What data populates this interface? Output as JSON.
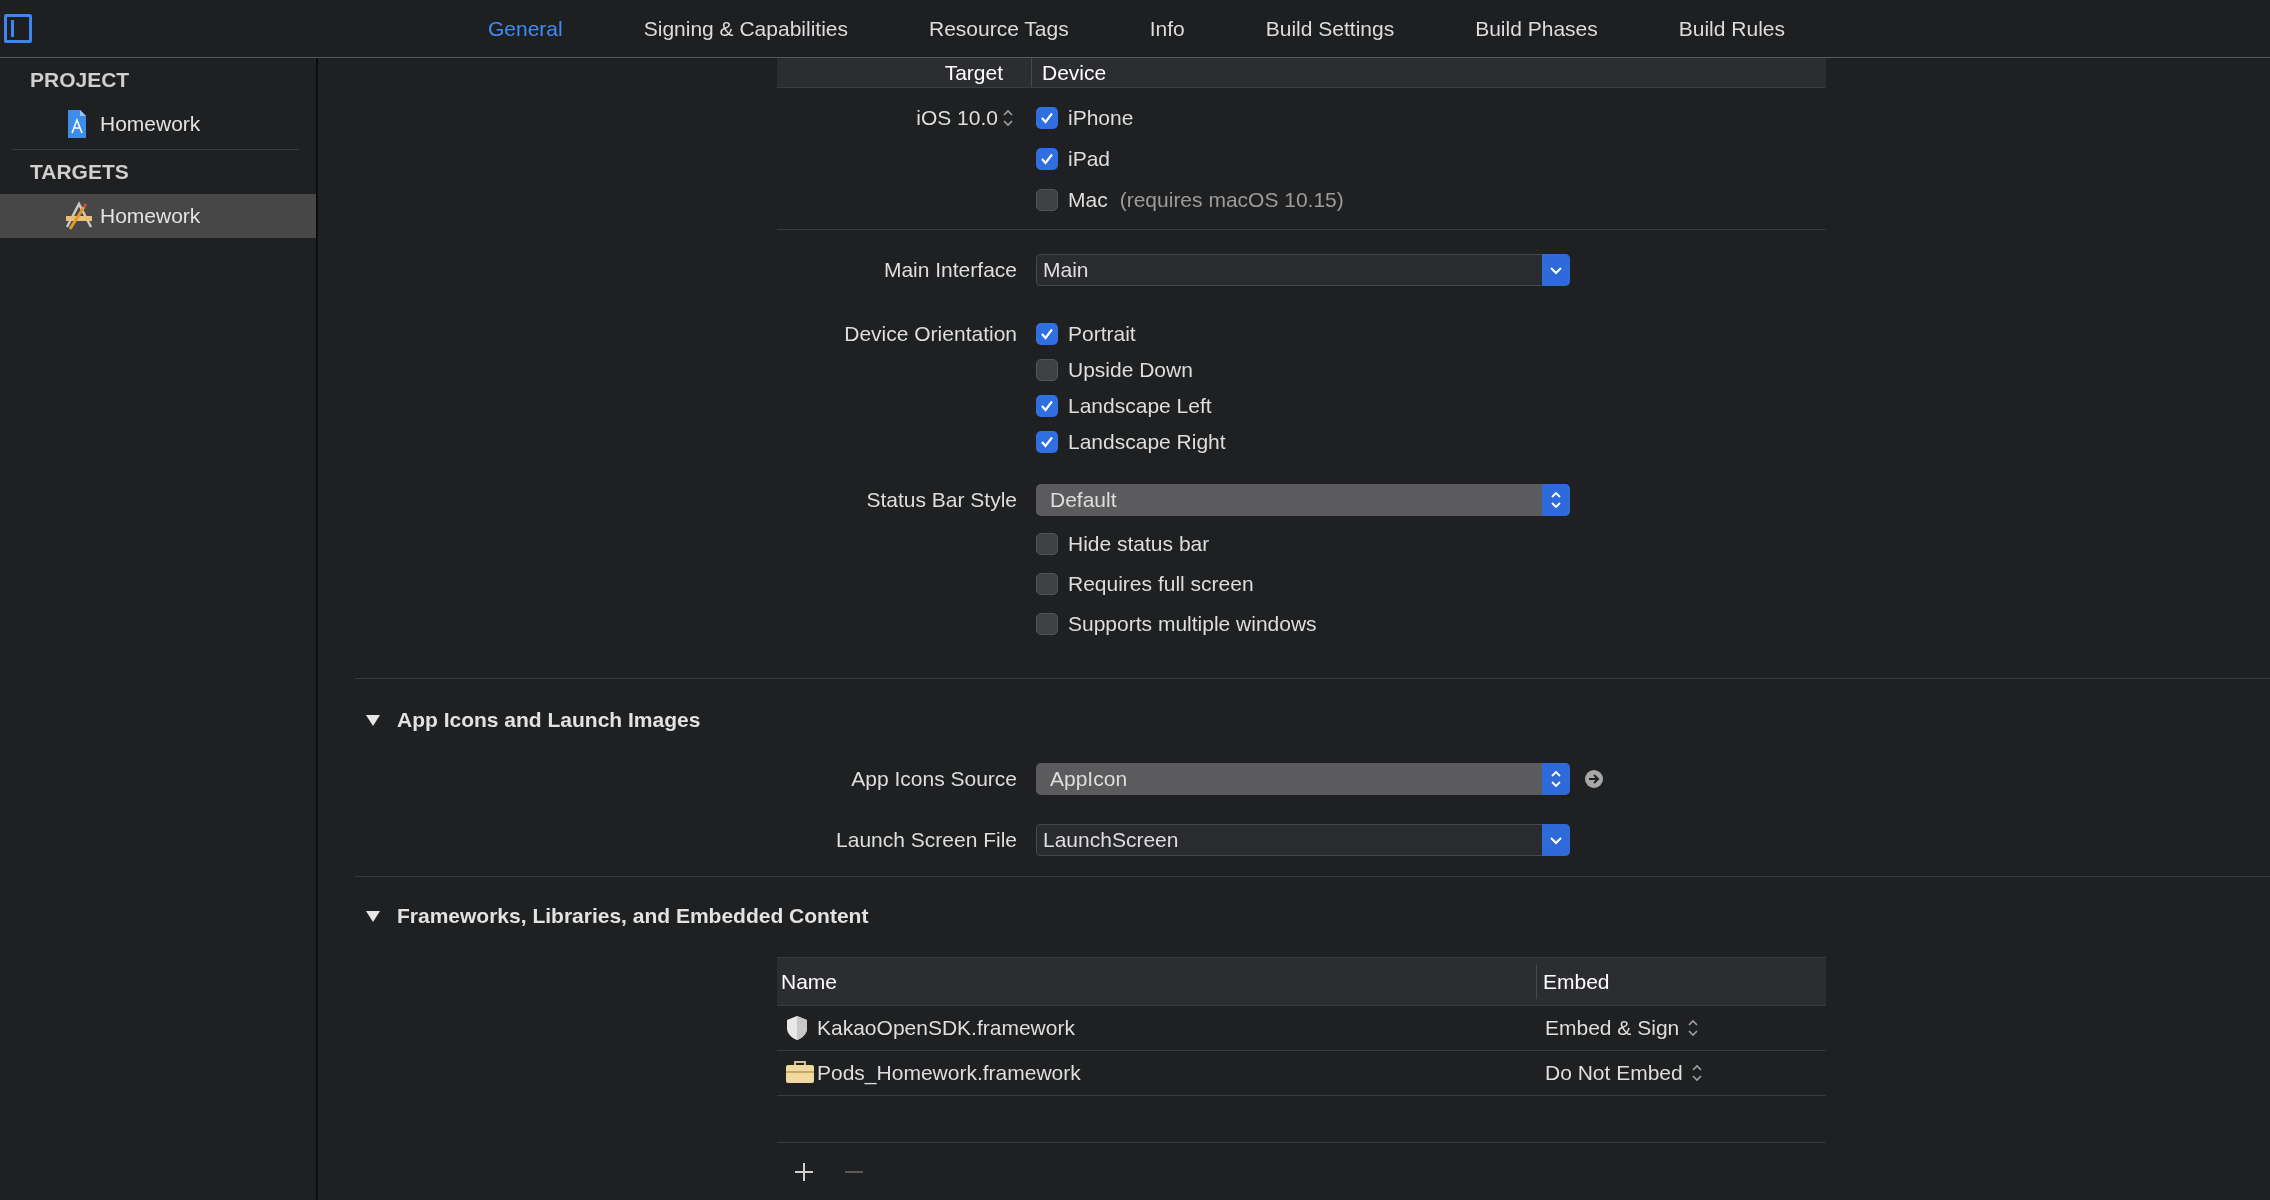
{
  "toolbar": {
    "tabs": [
      {
        "label": "General",
        "selected": true
      },
      {
        "label": "Signing & Capabilities",
        "selected": false
      },
      {
        "label": "Resource Tags",
        "selected": false
      },
      {
        "label": "Info",
        "selected": false
      },
      {
        "label": "Build Settings",
        "selected": false
      },
      {
        "label": "Build Phases",
        "selected": false
      },
      {
        "label": "Build Rules",
        "selected": false
      }
    ]
  },
  "sidebar": {
    "groups": [
      {
        "title": "PROJECT",
        "items": [
          {
            "label": "Homework",
            "kind": "project",
            "selected": false
          }
        ]
      },
      {
        "title": "TARGETS",
        "items": [
          {
            "label": "Homework",
            "kind": "target",
            "selected": true
          }
        ]
      }
    ]
  },
  "deployment_info": {
    "columns": [
      "Target",
      "Device"
    ],
    "version": "iOS 10.0",
    "devices": [
      {
        "label": "iPhone",
        "checked": true
      },
      {
        "label": "iPad",
        "checked": true
      },
      {
        "label": "Mac",
        "checked": false,
        "note": "(requires macOS 10.15)"
      }
    ],
    "rows": [
      {
        "kind": "combo",
        "label": "Main Interface",
        "value": "Main"
      },
      {
        "kind": "checks",
        "label": "Device Orientation",
        "options": [
          {
            "label": "Portrait",
            "checked": true
          },
          {
            "label": "Upside Down",
            "checked": false
          },
          {
            "label": "Landscape Left",
            "checked": true
          },
          {
            "label": "Landscape Right",
            "checked": true
          }
        ]
      },
      {
        "kind": "popup",
        "label": "Status Bar Style",
        "value": "Default"
      },
      {
        "kind": "checks",
        "options": [
          {
            "label": "Hide status bar",
            "checked": false
          },
          {
            "label": "Requires full screen",
            "checked": false
          },
          {
            "label": "Supports multiple windows",
            "checked": false
          }
        ]
      }
    ]
  },
  "sections": [
    {
      "kind": "form",
      "title": "App Icons and Launch Images",
      "expanded": true,
      "rows": [
        {
          "kind": "popup",
          "label": "App Icons Source",
          "value": "AppIcon",
          "link": true
        },
        {
          "kind": "combo",
          "label": "Launch Screen File",
          "value": "LaunchScreen"
        }
      ]
    },
    {
      "kind": "table",
      "title": "Frameworks, Libraries, and Embedded Content",
      "expanded": true,
      "columns": [
        "Name",
        "Embed"
      ],
      "rows": [
        {
          "name": "KakaoOpenSDK.framework",
          "kind": "sdk",
          "embed": "Embed & Sign"
        },
        {
          "name": "Pods_Homework.framework",
          "kind": "pods",
          "embed": "Do Not Embed"
        }
      ]
    }
  ]
}
